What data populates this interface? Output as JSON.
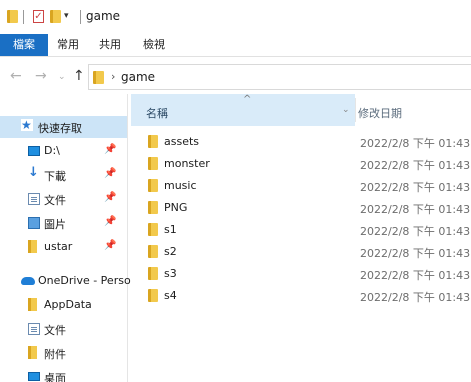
{
  "window": {
    "title": "game"
  },
  "ribbon": {
    "tabs": [
      "檔案",
      "常用",
      "共用",
      "檢視"
    ]
  },
  "address": {
    "separator": "›",
    "path": "game"
  },
  "nav": {
    "quick_access": "快速存取",
    "items": [
      {
        "label": "D:\\",
        "icon": "drive-icon",
        "pinned": true
      },
      {
        "label": "下載",
        "icon": "download-icon",
        "pinned": true
      },
      {
        "label": "文件",
        "icon": "document-icon",
        "pinned": true
      },
      {
        "label": "圖片",
        "icon": "picture-icon",
        "pinned": true
      },
      {
        "label": "ustar",
        "icon": "folder-icon",
        "pinned": true
      }
    ],
    "onedrive": "OneDrive - Perso",
    "onedrive_items": [
      {
        "label": "AppData",
        "icon": "folder-icon"
      },
      {
        "label": "文件",
        "icon": "document-icon"
      },
      {
        "label": "附件",
        "icon": "folder-icon"
      },
      {
        "label": "桌面",
        "icon": "desktop-icon"
      }
    ],
    "pin_glyph": "📌"
  },
  "columns": {
    "name": "名稱",
    "date": "修改日期"
  },
  "files": [
    {
      "name": "assets",
      "date": "2022/2/8 下午 01:43"
    },
    {
      "name": "monster",
      "date": "2022/2/8 下午 01:43"
    },
    {
      "name": "music",
      "date": "2022/2/8 下午 01:43"
    },
    {
      "name": "PNG",
      "date": "2022/2/8 下午 01:43"
    },
    {
      "name": "s1",
      "date": "2022/2/8 下午 01:43"
    },
    {
      "name": "s2",
      "date": "2022/2/8 下午 01:43"
    },
    {
      "name": "s3",
      "date": "2022/2/8 下午 01:43"
    },
    {
      "name": "s4",
      "date": "2022/2/8 下午 01:43"
    }
  ],
  "colors": {
    "accent": "#1a6fc4",
    "selection": "#cce4f7",
    "header_highlight": "#d9ebf9",
    "folder": "#f2c94c"
  }
}
